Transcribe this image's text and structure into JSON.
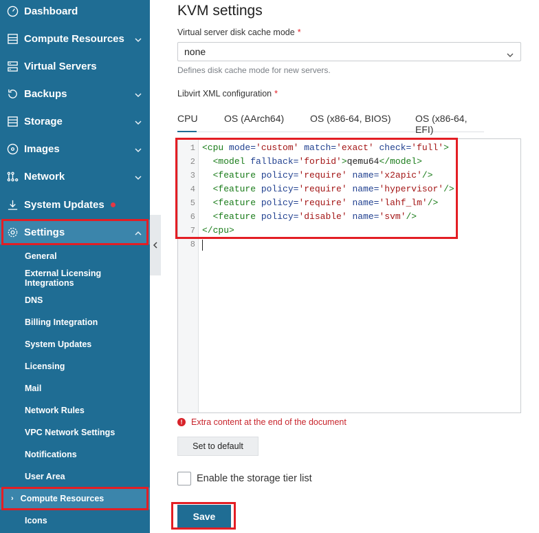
{
  "sidebar": {
    "nav": {
      "dashboard": "Dashboard",
      "compute_resources": "Compute Resources",
      "virtual_servers": "Virtual Servers",
      "backups": "Backups",
      "storage": "Storage",
      "images": "Images",
      "network": "Network",
      "system_updates": "System Updates",
      "settings": "Settings"
    },
    "settings_submenu": [
      "General",
      "External Licensing Integrations",
      "DNS",
      "Billing Integration",
      "System Updates",
      "Licensing",
      "Mail",
      "Network Rules",
      "VPC Network Settings",
      "Notifications",
      "User Area",
      "Compute Resources",
      "Icons"
    ]
  },
  "main": {
    "title": "KVM settings",
    "disk_cache": {
      "label": "Virtual server disk cache mode",
      "required_mark": "*",
      "value": "none",
      "hint": "Defines disk cache mode for new servers."
    },
    "libvirt": {
      "label": "Libvirt XML configuration",
      "required_mark": "*",
      "tabs": [
        "CPU",
        "OS (AArch64)",
        "OS (x86-64, BIOS)",
        "OS (x86-64, EFI)"
      ],
      "line_numbers": [
        "1",
        "2",
        "3",
        "4",
        "5",
        "6",
        "7",
        "8"
      ],
      "code": {
        "l1": {
          "open": "<cpu",
          "a1": " mode=",
          "v1": "'custom'",
          "a2": " match=",
          "v2": "'exact'",
          "a3": " check=",
          "v3": "'full'",
          "close": ">"
        },
        "l2": {
          "open": "<model",
          "a1": " fallback=",
          "v1": "'forbid'",
          "mid": ">",
          "text": "qemu64",
          "close": "</model>"
        },
        "l3": {
          "open": "<feature",
          "a1": " policy=",
          "v1": "'require'",
          "a2": " name=",
          "v2": "'x2apic'",
          "close": "/>"
        },
        "l4": {
          "open": "<feature",
          "a1": " policy=",
          "v1": "'require'",
          "a2": " name=",
          "v2": "'hypervisor'",
          "close": "/>"
        },
        "l5": {
          "open": "<feature",
          "a1": " policy=",
          "v1": "'require'",
          "a2": " name=",
          "v2": "'lahf_lm'",
          "close": "/>"
        },
        "l6": {
          "open": "<feature",
          "a1": " policy=",
          "v1": "'disable'",
          "a2": " name=",
          "v2": "'svm'",
          "close": "/>"
        },
        "l7": {
          "close": "</cpu>"
        }
      },
      "error": "Extra content at the end of the document",
      "error_icon": "!",
      "set_default_label": "Set to default"
    },
    "storage_tier": {
      "label": "Enable the storage tier list",
      "checked": false
    },
    "save_label": "Save"
  },
  "colors": {
    "sidebar_bg": "#1f6d94",
    "active_item": "#3b85ab",
    "highlight_frame": "#e31e24",
    "error": "#c8252c"
  }
}
